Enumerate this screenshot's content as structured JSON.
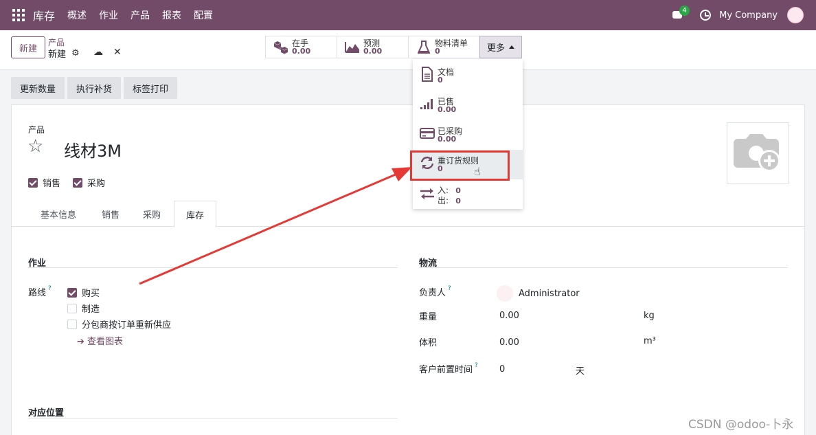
{
  "nav": {
    "app_name": "库存",
    "menu": [
      "概述",
      "作业",
      "产品",
      "报表",
      "配置"
    ],
    "notification_count": "4",
    "company": "My Company"
  },
  "control": {
    "new_button": "新建",
    "breadcrumb_parent": "产品",
    "breadcrumb_current": "新建",
    "smart_buttons": [
      {
        "label": "在手",
        "value": "0.00",
        "icon": "cubes-icon"
      },
      {
        "label": "预测",
        "value": "0.00",
        "icon": "area-chart-icon"
      },
      {
        "label": "物料清单",
        "value": "0",
        "icon": "flask-icon"
      }
    ],
    "more_button": "更多"
  },
  "dropdown": {
    "items": [
      {
        "label": "文档",
        "value": "0",
        "icon": "file-icon"
      },
      {
        "label": "已售",
        "value": "0.00",
        "icon": "signal-icon"
      },
      {
        "label": "已采购",
        "value": "0.00",
        "icon": "credit-card-icon"
      },
      {
        "label": "重订货规则",
        "value": "0",
        "icon": "refresh-icon"
      },
      {
        "label_in": "入:",
        "value_in": "0",
        "label_out": "出:",
        "value_out": "0",
        "icon": "exchange-icon"
      }
    ]
  },
  "actions": [
    "更新数量",
    "执行补货",
    "标签打印"
  ],
  "product": {
    "label": "产品",
    "name": "线材3M",
    "can_be_sold": "销售",
    "can_be_purchased": "采购"
  },
  "tabs": [
    "基本信息",
    "销售",
    "采购",
    "库存"
  ],
  "operations": {
    "title": "作业",
    "routes_label": "路线",
    "routes": [
      {
        "label": "购买",
        "checked": true
      },
      {
        "label": "制造",
        "checked": false
      },
      {
        "label": "分包商按订单重新供应",
        "checked": false
      }
    ],
    "view_diagram": "查看图表"
  },
  "logistics": {
    "title": "物流",
    "responsible_label": "负责人",
    "responsible_value": "Administrator",
    "weight_label": "重量",
    "weight_value": "0.00",
    "weight_unit": "kg",
    "volume_label": "体积",
    "volume_value": "0.00",
    "volume_unit": "m³",
    "lead_time_label": "客户前置时间",
    "lead_time_value": "0",
    "lead_time_unit": "天"
  },
  "counterpart": {
    "title": "对应位置"
  },
  "help_mark": "?",
  "watermark": "CSDN @odoo-卜永",
  "colors": {
    "brand": "#714b67",
    "annotation": "#e53935"
  }
}
